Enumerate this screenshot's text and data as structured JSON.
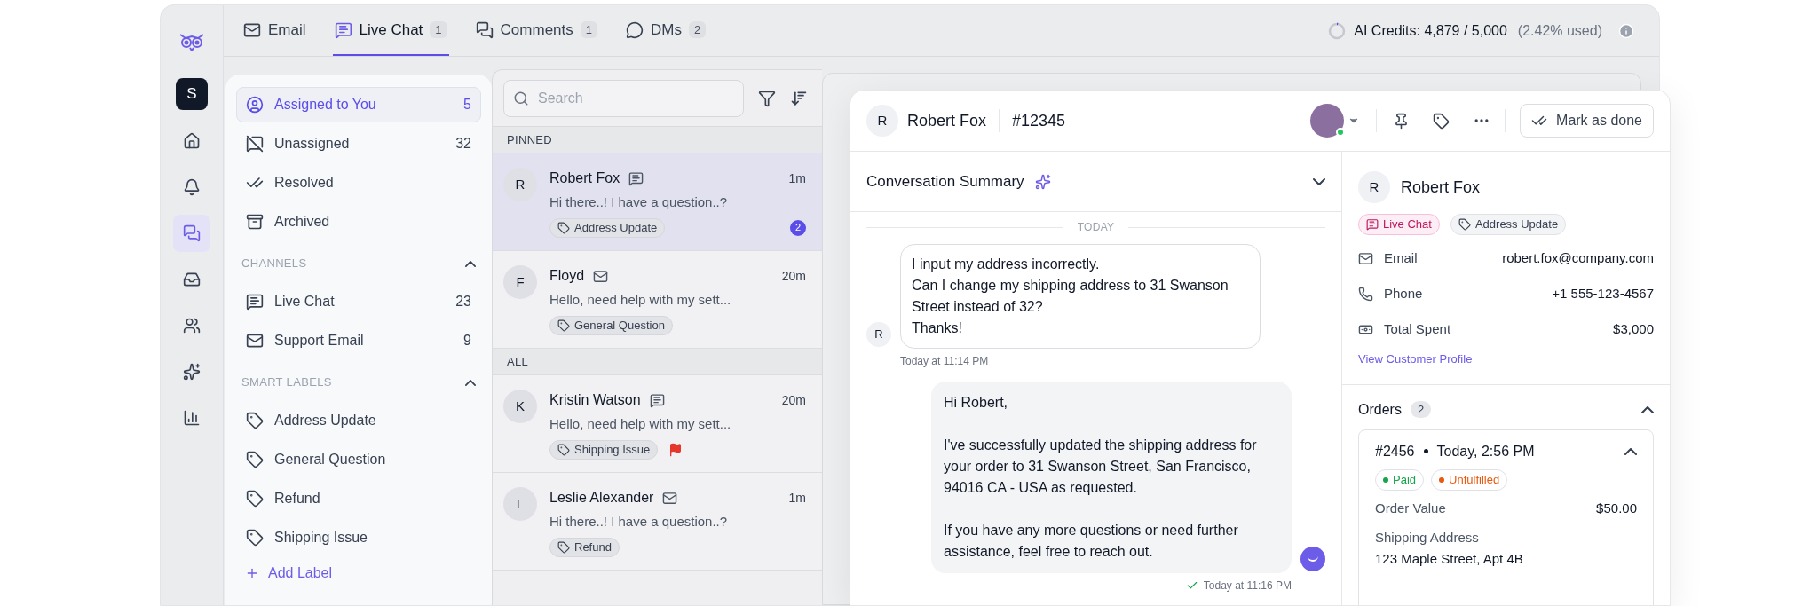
{
  "rail": {
    "workspace": "S",
    "items": [
      {
        "kind": "home",
        "selected": false
      },
      {
        "kind": "bell",
        "selected": false
      },
      {
        "kind": "chats",
        "selected": true
      },
      {
        "kind": "inbox",
        "selected": false
      },
      {
        "kind": "users",
        "selected": false
      },
      {
        "kind": "ai",
        "selected": false
      },
      {
        "kind": "reports",
        "selected": false
      }
    ]
  },
  "tabs": [
    {
      "kind": "email",
      "label": "Email",
      "selected": false
    },
    {
      "kind": "chat",
      "label": "Live Chat",
      "count": "1",
      "selected": true
    },
    {
      "kind": "comments",
      "label": "Comments",
      "count": "1",
      "selected": false
    },
    {
      "kind": "dms",
      "label": "DMs",
      "count": "2",
      "selected": false
    }
  ],
  "credits": {
    "label": "AI Credits: 4,879 / 5,000",
    "note": "(2.42% used)",
    "level": 0.0242
  },
  "nav": {
    "items": [
      {
        "kind": "assigned",
        "label": "Assigned to You",
        "count": "5",
        "selected": true
      },
      {
        "kind": "unassigned",
        "label": "Unassigned",
        "count": "32",
        "selected": false
      },
      {
        "kind": "resolved",
        "label": "Resolved",
        "selected": false
      },
      {
        "kind": "archived",
        "label": "Archived",
        "selected": false
      }
    ],
    "sections": [
      {
        "title": "CHANNELS",
        "expanded": true,
        "items": [
          {
            "kind": "chat",
            "label": "Live Chat",
            "count": "23",
            "selected": false
          },
          {
            "kind": "email",
            "label": "Support Email",
            "count": "9",
            "selected": false
          }
        ]
      },
      {
        "title": "SMART LABELS",
        "expanded": true,
        "items": [
          {
            "kind": "label",
            "label": "Address Update",
            "selected": false
          },
          {
            "kind": "label",
            "label": "General Question",
            "selected": false
          },
          {
            "kind": "label",
            "label": "Refund",
            "selected": false
          },
          {
            "kind": "label",
            "label": "Shipping Issue",
            "selected": false
          }
        ]
      }
    ],
    "add_label": "Add Label"
  },
  "search": {
    "placeholder": "Search"
  },
  "conversation_groups": [
    {
      "title": "PINNED",
      "conversations": [
        {
          "initial": "R",
          "name": "Robert Fox",
          "kind": "chat",
          "time": "1m",
          "preview": "Hi there..! I have a question..?",
          "tag": "Address Update",
          "unread": "2",
          "flagged": false,
          "selected": true
        },
        {
          "initial": "F",
          "name": "Floyd",
          "kind": "email",
          "time": "20m",
          "preview": "Hello, need help with my sett...",
          "tag": "General Question",
          "flagged": false,
          "selected": false
        }
      ]
    },
    {
      "title": "ALL",
      "conversations": [
        {
          "initial": "K",
          "name": "Kristin Watson",
          "kind": "chat",
          "time": "20m",
          "preview": "Hello, need help with my sett...",
          "tag": "Shipping Issue",
          "flagged": true,
          "selected": false
        },
        {
          "initial": "L",
          "name": "Leslie Alexander",
          "kind": "email",
          "time": "1m",
          "preview": "Hi there..! I have a question..?",
          "tag": "Refund",
          "flagged": false,
          "selected": false
        }
      ]
    }
  ],
  "chat": {
    "initial": "R",
    "contact": "Robert Fox",
    "ticket": "#12345",
    "assignee_online": true,
    "action": "Mark as done",
    "summary": {
      "title": "Conversation Summary",
      "expanded": false
    },
    "day": "TODAY",
    "messages": [
      {
        "kind": "incoming",
        "initial": "R",
        "paragraphs": [
          "I input my address incorrectly.",
          "Can I change my shipping address to 31 Swanson Street instead of 32?",
          "Thanks!"
        ],
        "time": "Today at 11:14 PM"
      },
      {
        "kind": "outgoing",
        "paragraphs": [
          "Hi Robert,",
          "I've successfully updated the shipping address for your order to 31 Swanson Street, San Francisco, 94016 CA - USA as requested.",
          "If you have any more questions or need further assistance, feel free to reach out."
        ],
        "time": "Today at 11:16 PM",
        "delivered": true
      }
    ]
  },
  "customer": {
    "initial": "R",
    "name": "Robert Fox",
    "channel_tag": "Live Chat",
    "label_tag": "Address Update",
    "fields": [
      {
        "kind": "email",
        "label": "Email",
        "value": "robert.fox@company.com"
      },
      {
        "kind": "phone",
        "label": "Phone",
        "value": "+1 555-123-4567"
      },
      {
        "kind": "money",
        "label": "Total Spent",
        "value": "$3,000"
      }
    ],
    "profile_link": "View Customer Profile"
  },
  "orders": {
    "title": "Orders",
    "count": "2",
    "expanded": true,
    "items": [
      {
        "number": "#2456",
        "date": "Today, 2:56 PM",
        "expanded": true,
        "statuses": [
          {
            "label": "Paid",
            "color": "#16a34a"
          },
          {
            "label": "Unfulfilled",
            "color": "#ea580c"
          }
        ],
        "fields": [
          {
            "label": "Order Value",
            "value": "$50.00"
          }
        ],
        "shipping_label": "Shipping Address",
        "shipping": "123 Maple Street, Apt 4B"
      }
    ]
  }
}
